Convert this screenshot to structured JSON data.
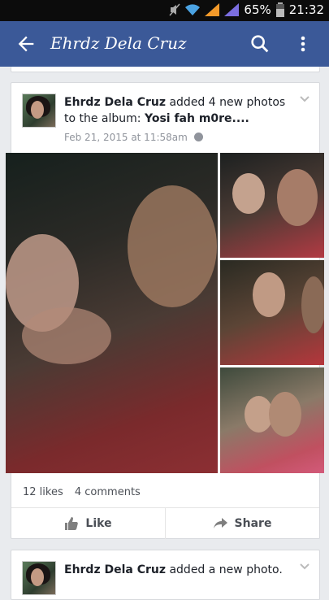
{
  "status_bar": {
    "battery": "65%",
    "time": "21:32"
  },
  "app_bar": {
    "title": "Ehrdz Dela Cruz",
    "back_icon": "arrow-back-icon",
    "search_icon": "search-icon",
    "more_icon": "more-vert-icon"
  },
  "post": {
    "author": "Ehrdz Dela Cruz",
    "action_text": "added 4 new photos to the album:",
    "album": "Yosi fah m0re....",
    "timestamp": "Feb 21, 2015 at 11:58am",
    "likes": "12 likes",
    "comments": "4 comments",
    "like_label": "Like",
    "share_label": "Share"
  },
  "next_post": {
    "author": "Ehrdz Dela Cruz",
    "action_text": "added a new photo."
  },
  "colors": {
    "brand": "#3b5998",
    "background": "#e9ebee"
  }
}
